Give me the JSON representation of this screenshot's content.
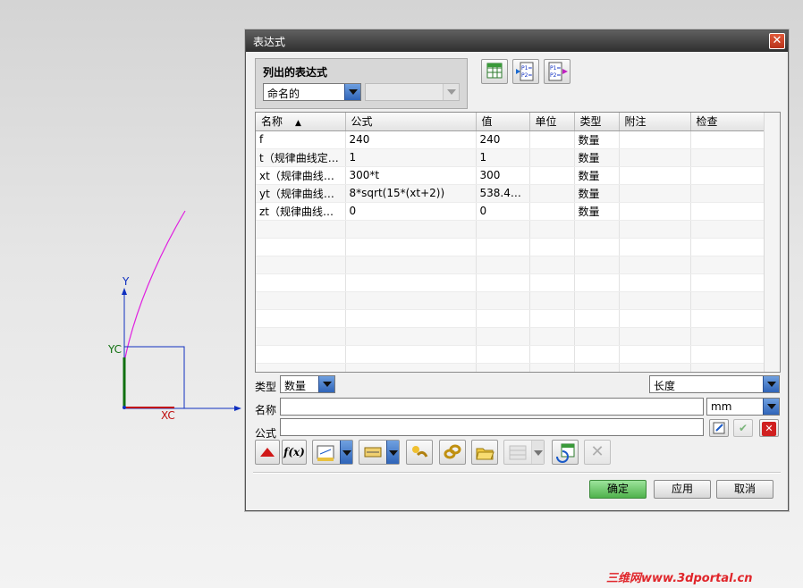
{
  "viewport": {
    "axis_y_label": "Y",
    "axis_yc_label": "YC",
    "axis_xc_label": "XC"
  },
  "dialog": {
    "title": "表达式",
    "list_group": {
      "title": "列出的表达式",
      "filter_value": "命名的",
      "secondary_value": ""
    },
    "table": {
      "columns": [
        "名称",
        "公式",
        "值",
        "单位",
        "类型",
        "附注",
        "检查"
      ],
      "rows": [
        {
          "name": "f",
          "formula": "240",
          "value": "240",
          "unit": "",
          "type": "数量",
          "note": "",
          "check": ""
        },
        {
          "name": "t（规律曲线定…",
          "formula": "1",
          "value": "1",
          "unit": "",
          "type": "数量",
          "note": "",
          "check": ""
        },
        {
          "name": "xt（规律曲线定…",
          "formula": "300*t",
          "value": "300",
          "unit": "",
          "type": "数量",
          "note": "",
          "check": ""
        },
        {
          "name": "yt（规律曲线定…",
          "formula": "8*sqrt(15*(xt+2))",
          "value": "538.44…",
          "unit": "",
          "type": "数量",
          "note": "",
          "check": ""
        },
        {
          "name": "zt（规律曲线定…",
          "formula": "0",
          "value": "0",
          "unit": "",
          "type": "数量",
          "note": "",
          "check": ""
        }
      ]
    },
    "type_label": "类型",
    "type_value": "数量",
    "dimension_value": "长度",
    "name_label": "名称",
    "name_value": "",
    "unit_value": "mm",
    "formula_label": "公式",
    "formula_value": "",
    "buttons": {
      "ok": "确定",
      "apply": "应用",
      "cancel": "取消",
      "fx": "f(x)"
    }
  },
  "watermark": "三维网www.3dportal.cn",
  "colors": {
    "titlebar": "#3a3a3a",
    "curve": "#e020e0",
    "axis_blue": "#1030c0",
    "axis_red": "#c01010",
    "axis_green": "#107010",
    "ok_button": "#5cbf5a"
  }
}
